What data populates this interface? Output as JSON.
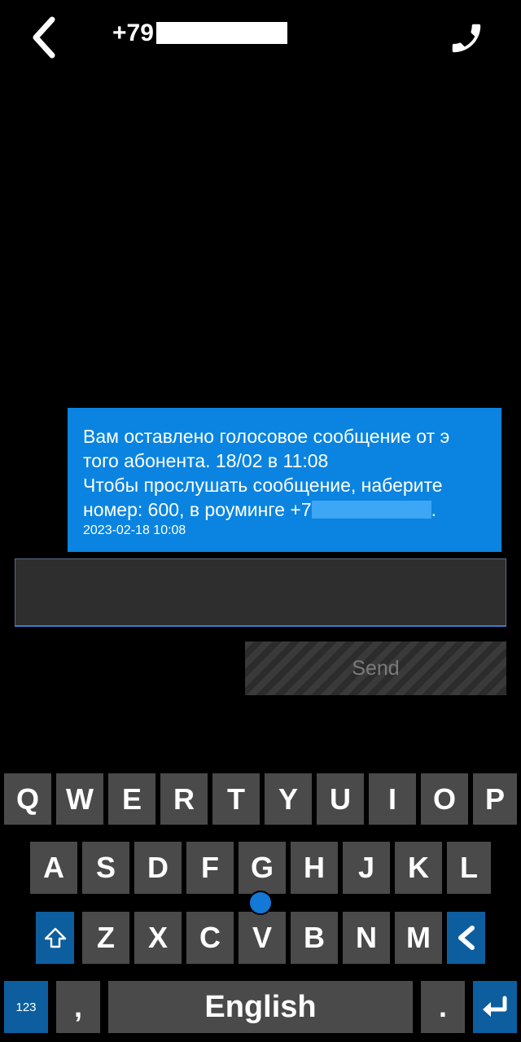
{
  "header": {
    "contact_number": "+79"
  },
  "message": {
    "text_line1": "Вам оставлено голосовое сообщение от э",
    "text_line2": "того абонента. 18/02 в 11:08",
    "text_line3": "Чтобы прослушать сообщение, наберите",
    "text_line4_prefix": "номер: 600, в роуминге +7",
    "text_line4_suffix": ".",
    "timestamp": "2023-02-18 10:08"
  },
  "composer": {
    "input_value": "",
    "send_label": "Send"
  },
  "keyboard": {
    "row1": [
      "Q",
      "W",
      "E",
      "R",
      "T",
      "Y",
      "U",
      "I",
      "O",
      "P"
    ],
    "row2": [
      "A",
      "S",
      "D",
      "F",
      "G",
      "H",
      "J",
      "K",
      "L"
    ],
    "row3": [
      "Z",
      "X",
      "C",
      "V",
      "B",
      "N",
      "M"
    ],
    "numbers_label": "123",
    "comma_label": ",",
    "space_label": "English",
    "period_label": "."
  },
  "colors": {
    "bubble": "#0a84e0",
    "key": "#4a4a4a",
    "accent_key": "#0d5e9e",
    "background": "#000000"
  },
  "icons": {
    "back": "chevron-left-icon",
    "call": "phone-icon",
    "shift": "shift-arrow-icon",
    "backspace": "backspace-chevron-icon",
    "enter": "enter-return-icon"
  }
}
